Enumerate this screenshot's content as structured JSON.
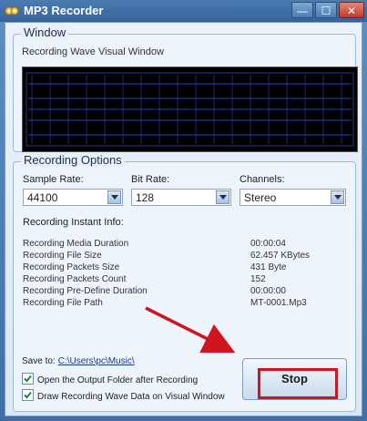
{
  "window": {
    "title": "MP3 Recorder"
  },
  "titlebar": {
    "min": "—",
    "max": "☐",
    "close": "✕"
  },
  "wave_group": {
    "title": "Window",
    "label": "Recording Wave Visual Window"
  },
  "options": {
    "title": "Recording Options",
    "sample_rate": {
      "label": "Sample Rate:",
      "value": "44100"
    },
    "bit_rate": {
      "label": "Bit Rate:",
      "value": "128"
    },
    "channels": {
      "label": "Channels:",
      "value": "Stereo"
    },
    "info_title": "Recording Instant Info:",
    "info": [
      {
        "key": "Recording Media Duration",
        "value": "00:00:04"
      },
      {
        "key": "Recording File Size",
        "value": "62.457  KBytes"
      },
      {
        "key": "Recording Packets Size",
        "value": "431 Byte"
      },
      {
        "key": "Recording Packets Count",
        "value": "152"
      },
      {
        "key": "Recording Pre-Define Duration",
        "value": "00:00:00"
      },
      {
        "key": "Recording File Path",
        "value": "MT-0001.Mp3"
      }
    ],
    "save_to_label": "Save to:",
    "save_to_path": "C:\\Users\\pc\\Music\\",
    "check_open_folder": "Open the Output Folder after Recording",
    "check_draw_wave": "Draw Recording Wave Data on Visual Window",
    "stop_button": "Stop"
  },
  "colors": {
    "accent_red": "#d2141e",
    "wave_bg": "#000000",
    "wave_line": "#1f3fbf"
  }
}
